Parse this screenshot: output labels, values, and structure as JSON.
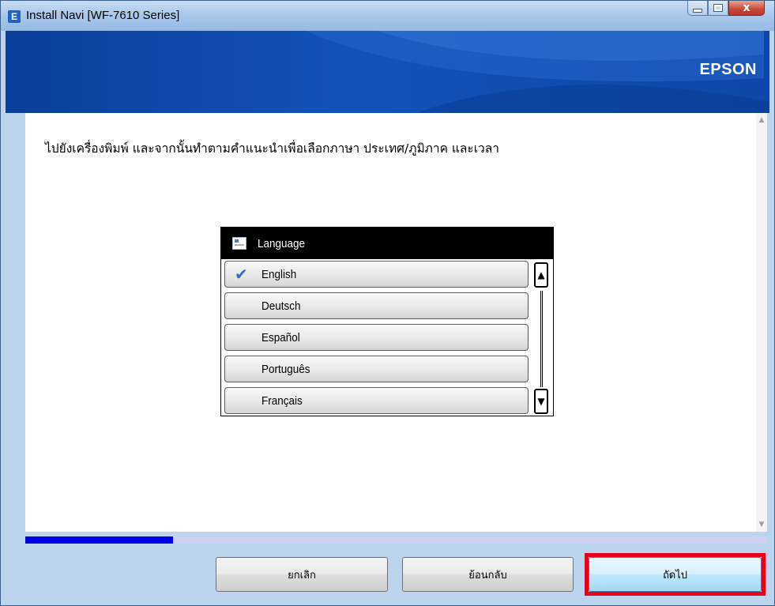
{
  "window": {
    "title": "Install Navi [WF-7610 Series]",
    "app_icon_letter": "E",
    "controls": {
      "minimize": "",
      "maximize": "",
      "close": "x"
    }
  },
  "header": {
    "brand": "EPSON"
  },
  "instruction": "ไปยังเครื่องพิมพ์ และจากนั้นทำตามคำแนะนำเพื่อเลือกภาษา ประเทศ/ภูมิภาค และเวลา",
  "lcd": {
    "title": "Language",
    "items": [
      {
        "label": "English",
        "selected": true
      },
      {
        "label": "Deutsch",
        "selected": false
      },
      {
        "label": "Español",
        "selected": false
      },
      {
        "label": "Português",
        "selected": false
      },
      {
        "label": "Français",
        "selected": false
      }
    ],
    "check_mark": "✔",
    "arrow_up": "▲",
    "arrow_down": "▼"
  },
  "scrollbar": {
    "up": "▲",
    "down": "▼"
  },
  "progress": {
    "fraction": 0.2
  },
  "buttons": {
    "cancel": "ยกเลิก",
    "back": "ย้อนกลับ",
    "next": "ถัดไป"
  },
  "colors": {
    "header_blue": "#1252b8",
    "progress_fill": "#0000e6",
    "highlight_red": "#e8001b"
  }
}
